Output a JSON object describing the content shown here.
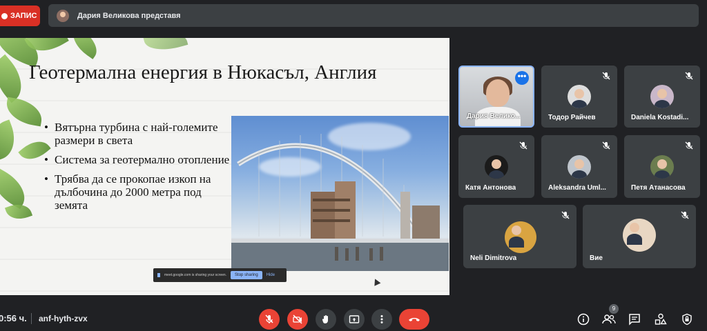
{
  "top": {
    "record_label": "ЗАПИС",
    "presenter_text": "Дария Великова представя"
  },
  "slide": {
    "title": "Геотермална енергия в Нюкасъл, Англия",
    "bullets": [
      "Вятърна турбина с най-големите размери в света",
      "Система за геотермално отопление",
      "Трябва да се прокопае изкоп на дълбочина до 2000 метра под земята"
    ],
    "share_notice": "meet.google.com is sharing your screen.",
    "stop_sharing": "Stop sharing",
    "hide": "Hide"
  },
  "participants": [
    {
      "name": "Дария Велико...",
      "muted": false,
      "video": true
    },
    {
      "name": "Тодор Райчев",
      "muted": true
    },
    {
      "name": "Daniela Kostadi...",
      "muted": true
    },
    {
      "name": "Катя Антонова",
      "muted": true
    },
    {
      "name": "Aleksandra Uml...",
      "muted": true
    },
    {
      "name": "Петя Атанасова",
      "muted": true
    },
    {
      "name": "Neli Dimitrova",
      "muted": true
    },
    {
      "name": "Вие",
      "muted": true
    }
  ],
  "more_options_glyph": "•••",
  "bottom": {
    "time": "0:56 ч.",
    "meeting_code": "anf-hyth-zvx",
    "people_count": "9"
  },
  "colors": {
    "background": "#202124",
    "tile": "#3c4043",
    "danger": "#ea4335",
    "accent": "#8ab4f8"
  }
}
